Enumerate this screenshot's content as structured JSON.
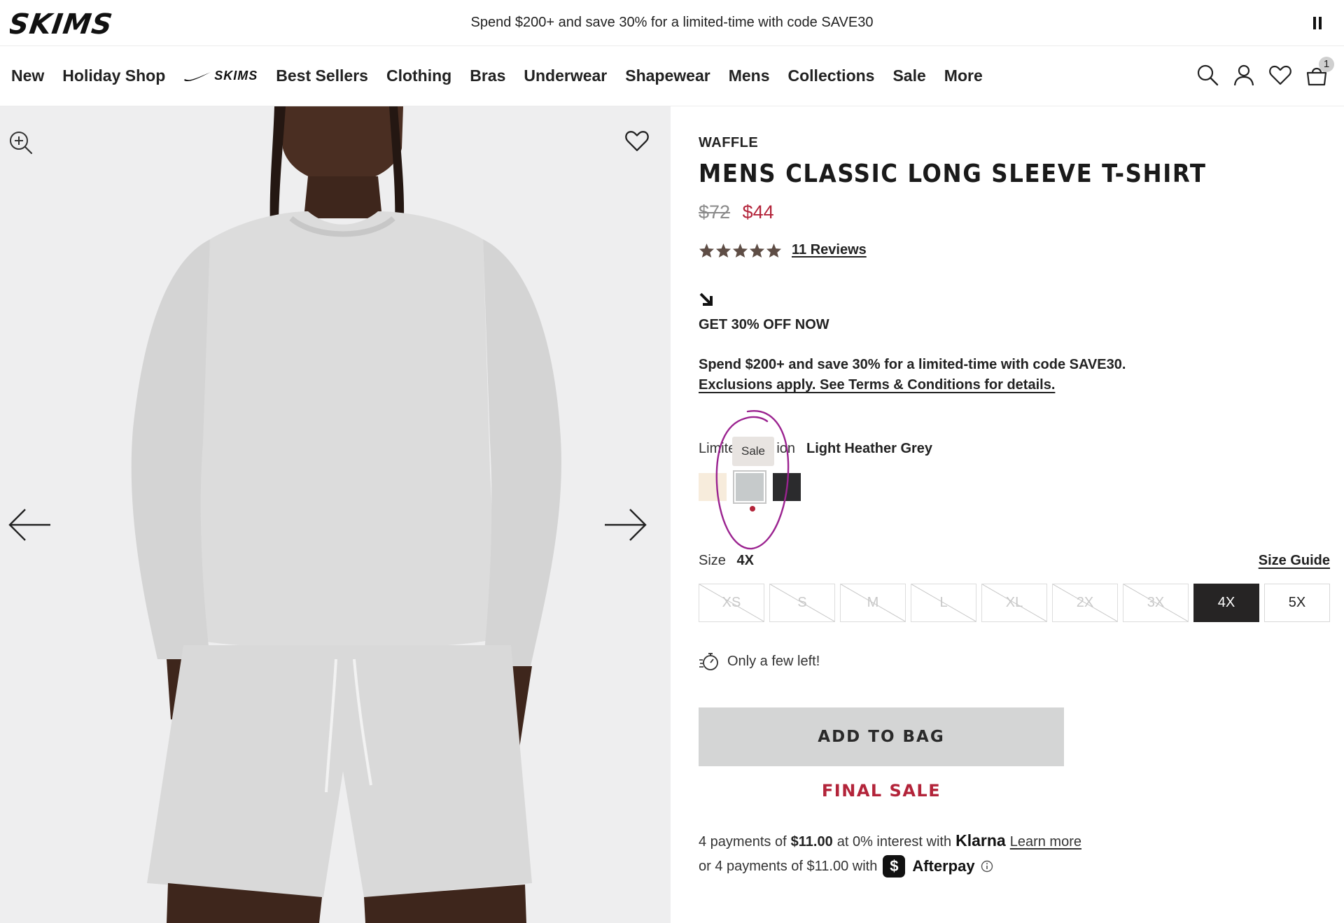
{
  "announcement": {
    "text": "Spend $200+ and save 30% for a limited-time with code SAVE30"
  },
  "brand": {
    "logo_text": "SKIMS"
  },
  "nav": {
    "items": [
      {
        "label": "New"
      },
      {
        "label": "Holiday Shop"
      }
    ],
    "collab_label": "SKIMS",
    "items_after": [
      {
        "label": "Best Sellers"
      },
      {
        "label": "Clothing"
      },
      {
        "label": "Bras"
      },
      {
        "label": "Underwear"
      },
      {
        "label": "Shapewear"
      },
      {
        "label": "Mens"
      },
      {
        "label": "Collections"
      },
      {
        "label": "Sale"
      },
      {
        "label": "More"
      }
    ],
    "bag_count": "1"
  },
  "product": {
    "category": "WAFFLE",
    "title": "MENS CLASSIC LONG SLEEVE T-SHIRT",
    "price_original": "$72",
    "price_sale": "$44",
    "rating": 5,
    "reviews_label": "11 Reviews",
    "promo": {
      "heading": "GET 30% OFF NOW",
      "line1": "Spend $200+ and save 30% for a limited-time with code SAVE30.",
      "line2": "Exclusions apply. See Terms & Conditions for details."
    },
    "color": {
      "label_visible_start": "Limite",
      "label_visible_end": "ion",
      "selected_name": "Light Heather Grey",
      "tooltip": "Sale",
      "swatches": [
        {
          "color": "#f7ecdc",
          "selected": false
        },
        {
          "color": "#c6cacb",
          "selected": true
        },
        {
          "color": "#2b2b2d",
          "selected": false
        }
      ]
    },
    "size": {
      "label": "Size",
      "selected": "4X",
      "guide_label": "Size Guide",
      "options": [
        {
          "label": "XS",
          "available": false
        },
        {
          "label": "S",
          "available": false
        },
        {
          "label": "M",
          "available": false
        },
        {
          "label": "L",
          "available": false
        },
        {
          "label": "XL",
          "available": false
        },
        {
          "label": "2X",
          "available": false
        },
        {
          "label": "3X",
          "available": false
        },
        {
          "label": "4X",
          "available": true,
          "selected": true
        },
        {
          "label": "5X",
          "available": true
        }
      ]
    },
    "stock_message": "Only a few left!",
    "add_to_bag": "ADD TO BAG",
    "final_sale": "FINAL SALE",
    "klarna": {
      "prefix": "4 payments of",
      "amount": "$11.00",
      "middle": "at 0% interest with",
      "logo": "Klarna",
      "link": "Learn more"
    },
    "afterpay": {
      "text": "or 4 payments of $11.00 with",
      "badge": "$",
      "name": "Afterpay"
    }
  },
  "colors": {
    "accent_red": "#b3243a",
    "selected_size_bg": "#262424",
    "add_to_bag_bg": "#d4d5d5",
    "annotation": "#9b2390",
    "star": "#5e4d45"
  }
}
